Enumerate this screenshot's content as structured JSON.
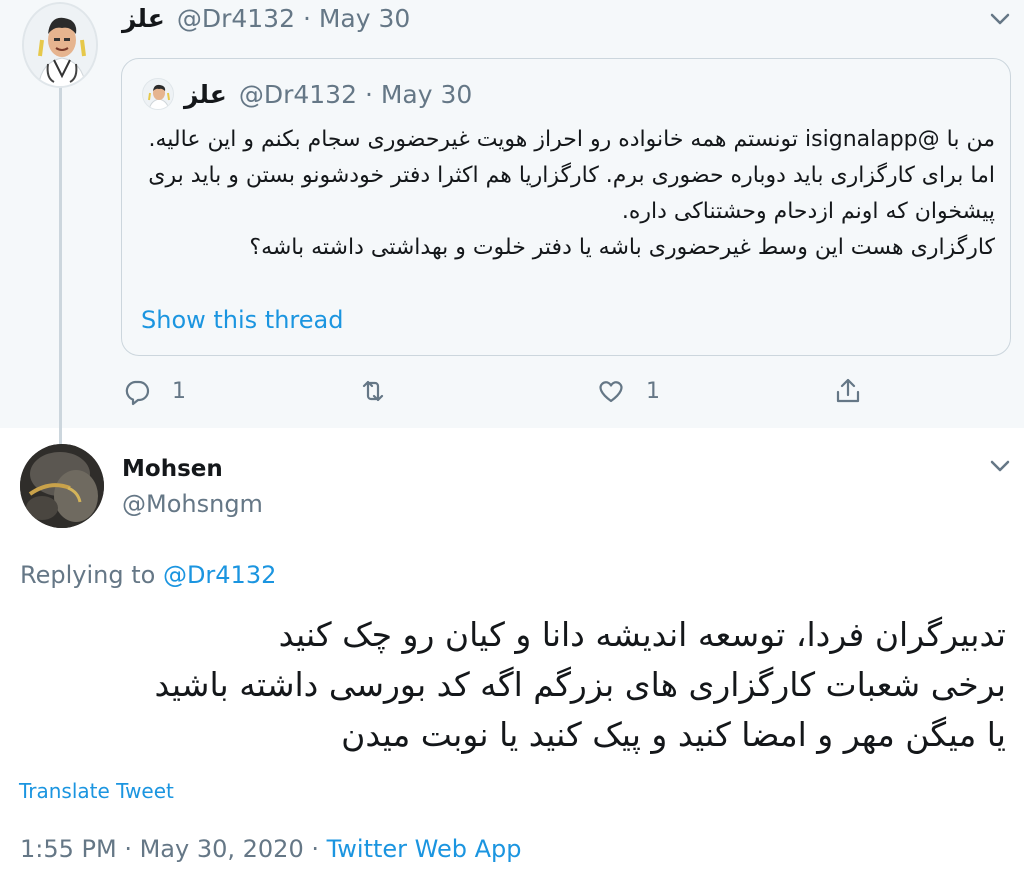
{
  "parent_tweet": {
    "author_name": "علز",
    "author_handle": "@Dr4132",
    "date": "May 30",
    "handle_date": "@Dr4132 · May 30",
    "quoted": {
      "author_name": "علز",
      "handle_date": "@Dr4132 · May 30",
      "lines": [
        "من با @isignalapp تونستم همه خانواده رو احراز هویت غیرحضوری سجام بکنم و این عالیه.",
        "اما برای کارگزاری باید دوباره حضوری برم. کارگزاریا هم اکثرا دفتر خودشونو بستن و باید بری پیشخوان که اونم ازدحام وحشتناکی داره.",
        "کارگزاری هست این وسط غیرحضوری باشه یا دفتر خلوت و بهداشتی داشته باشه؟"
      ],
      "show_thread": "Show this thread"
    },
    "actions": {
      "reply_icon": "reply-icon",
      "reply_count": "1",
      "retweet_icon": "retweet-icon",
      "like_icon": "heart-icon",
      "like_count": "1",
      "share_icon": "share-icon"
    }
  },
  "reply_tweet": {
    "author_name": "Mohsen",
    "author_handle": "@Mohsngm",
    "replying_prefix": "Replying to ",
    "replying_to": "@Dr4132",
    "lines": [
      "تدبیرگران فردا، توسعه اندیشه دانا و کیان رو چک کنید",
      "برخی شعبات کارگزاری های بزرگم اگه کد بورسی داشته باشید",
      "یا میگن مهر و امضا کنید و پیک کنید یا نوبت میدن"
    ],
    "translate": "Translate Tweet",
    "time_date": "1:55 PM · May 30, 2020 · ",
    "source": "Twitter Web App"
  },
  "colors": {
    "accent": "#1b95e0",
    "secondary_text": "#657786",
    "background_parent": "#f5f8fa",
    "border": "#ccd6dd"
  }
}
